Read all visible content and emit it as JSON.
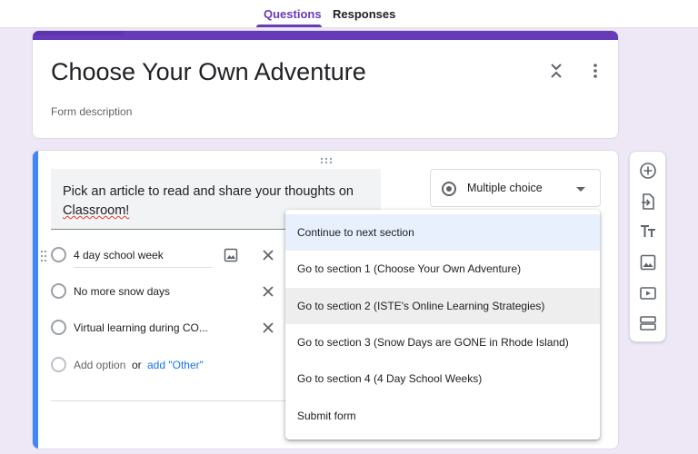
{
  "tabs": {
    "questions": "Questions",
    "responses": "Responses"
  },
  "form": {
    "title": "Choose Your Own Adventure",
    "description_placeholder": "Form description"
  },
  "question": {
    "title_part1": "Pick an article to read and share your thoughts on",
    "title_part2": "Classroom!",
    "type": "Multiple choice",
    "options": [
      "4 day school week",
      "No more snow days",
      "Virtual learning during CO..."
    ],
    "add_option": "Add option",
    "or": "or",
    "add_other": "add \"Other\""
  },
  "menu": {
    "items": [
      "Continue to next section",
      "Go to section 1 (Choose Your Own Adventure)",
      "Go to section 2 (ISTE's Online Learning Strategies)",
      "Go to section 3 (Snow Days are GONE in Rhode Island)",
      "Go to section 4 (4 Day School Weeks)",
      "Submit form"
    ],
    "selected_index": 0,
    "hovered_index": 2
  },
  "colors": {
    "theme": "#673ab7",
    "accent": "#4285f4",
    "link": "#1a73e8",
    "background": "#ede7f6"
  },
  "toolbar_icons": [
    "add-question-icon",
    "import-questions-icon",
    "add-title-icon",
    "add-image-icon",
    "add-video-icon",
    "add-section-icon"
  ]
}
